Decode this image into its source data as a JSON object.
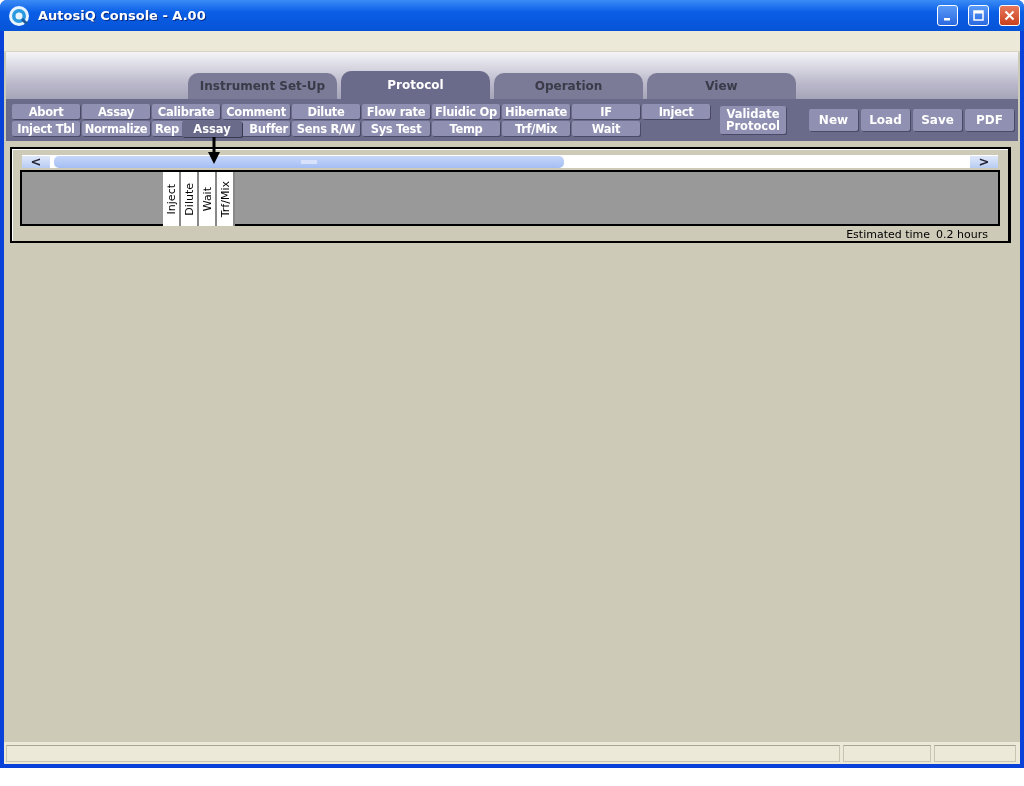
{
  "window": {
    "title": "AutosiQ Console - A.00"
  },
  "tabs": [
    {
      "label": "Instrument Set-Up",
      "selected": false
    },
    {
      "label": "Protocol",
      "selected": true
    },
    {
      "label": "Operation",
      "selected": false
    },
    {
      "label": "View",
      "selected": false
    }
  ],
  "step_buttons": [
    [
      "Abort",
      "Assay",
      "Calibrate",
      "Comment",
      "Dilute",
      "Flow rate",
      "Fluidic Op",
      "Hibernate",
      "IF",
      "Inject"
    ],
    [
      "Inject Tbl",
      "Normalize",
      {
        "label": "Rep",
        "kind": "cut_end"
      },
      {
        "label": "Buffer",
        "kind": "cut_start"
      },
      "Sens R/W",
      "Sys Test",
      "Temp",
      "Trf/Mix",
      "Wait"
    ]
  ],
  "validate_button": "Validate Protocol",
  "file_buttons": [
    "New",
    "Load",
    "Save",
    "PDF"
  ],
  "drag_label": "Assay",
  "timeline": {
    "scroll_left": "<",
    "scroll_right": ">",
    "steps": [
      "Inject",
      "Dilute",
      "Wait",
      "Trf/Mix"
    ],
    "estimated_label": "Estimated time",
    "estimated_value": "0.2 hours"
  }
}
